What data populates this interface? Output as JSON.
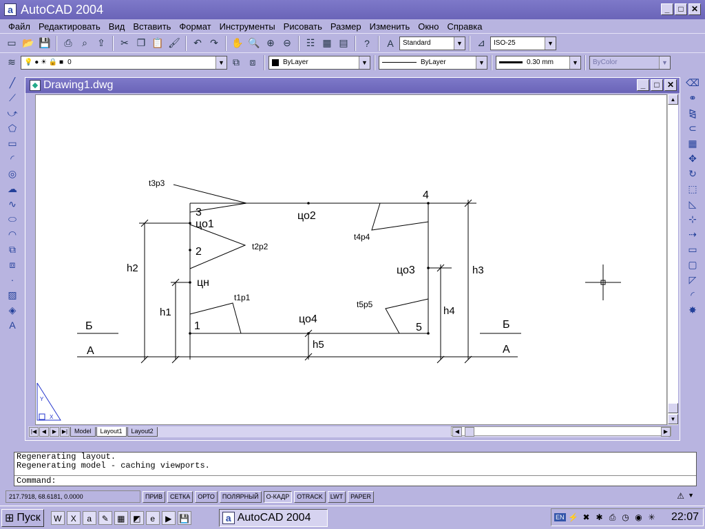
{
  "app": {
    "title": "AutoCAD 2004",
    "icon": "a"
  },
  "window_buttons": {
    "minimize": "_",
    "maximize": "□",
    "close": "✕"
  },
  "menu": [
    "Файл",
    "Редактировать",
    "Вид",
    "Вставить",
    "Формат",
    "Инструменты",
    "Рисовать",
    "Размер",
    "Изменить",
    "Окно",
    "Справка"
  ],
  "toolbar1": {
    "icons": [
      "new-icon",
      "open-icon",
      "save-icon",
      "print-icon",
      "preview-icon",
      "publish-icon",
      "cut-icon",
      "copy-icon",
      "paste-icon",
      "matchprop-icon",
      "undo-icon",
      "redo-icon",
      "pan-icon",
      "zoom-realtime-icon",
      "zoom-window-icon",
      "zoom-previous-icon",
      "properties-icon",
      "designcenter-icon",
      "toolpalettes-icon",
      "help-icon"
    ],
    "text_style": "Standard",
    "dim_style": "ISO-25"
  },
  "toolbar2": {
    "layer": "0",
    "color": "ByLayer",
    "linetype": "ByLayer",
    "lineweight": "0.30 mm",
    "plotstyle": "ByColor"
  },
  "document": {
    "title": "Drawing1.dwg"
  },
  "drawing": {
    "labels": {
      "p1": "1",
      "p2": "2",
      "p3": "3",
      "p4": "4",
      "p5": "5",
      "co1": "цо1",
      "co2": "цо2",
      "co3": "цо3",
      "co4": "цо4",
      "cn": "цн",
      "t1": "t1p1",
      "t2": "t2p2",
      "t3": "t3p3",
      "t4": "t4p4",
      "t5": "t5p5",
      "h1": "h1",
      "h2": "h2",
      "h3": "h3",
      "h4": "h4",
      "h5": "h5",
      "b_left": "Б",
      "b_right": "Б",
      "a_left": "А",
      "a_right": "А",
      "ucs_y": "Y",
      "ucs_x": "X"
    }
  },
  "layout_tabs": [
    "Model",
    "Layout1",
    "Layout2"
  ],
  "active_tab": "Layout1",
  "command": {
    "lines": [
      "Regenerating layout.",
      "Regenerating model - caching viewports."
    ],
    "prompt": "Command:"
  },
  "status": {
    "coords": "217.7918, 68.6181, 0.0000",
    "buttons": [
      {
        "label": "ПРИВ",
        "on": false
      },
      {
        "label": "СЕТКА",
        "on": false
      },
      {
        "label": "ОРТО",
        "on": false
      },
      {
        "label": "ПОЛЯРНЫЙ",
        "on": false
      },
      {
        "label": "О-КАДР",
        "on": true
      },
      {
        "label": "OTRACK",
        "on": false
      },
      {
        "label": "LWT",
        "on": false
      },
      {
        "label": "PAPER",
        "on": false
      }
    ]
  },
  "taskbar": {
    "start": "Пуск",
    "task": "AutoCAD 2004",
    "lang": "EN",
    "clock": "22:07"
  }
}
